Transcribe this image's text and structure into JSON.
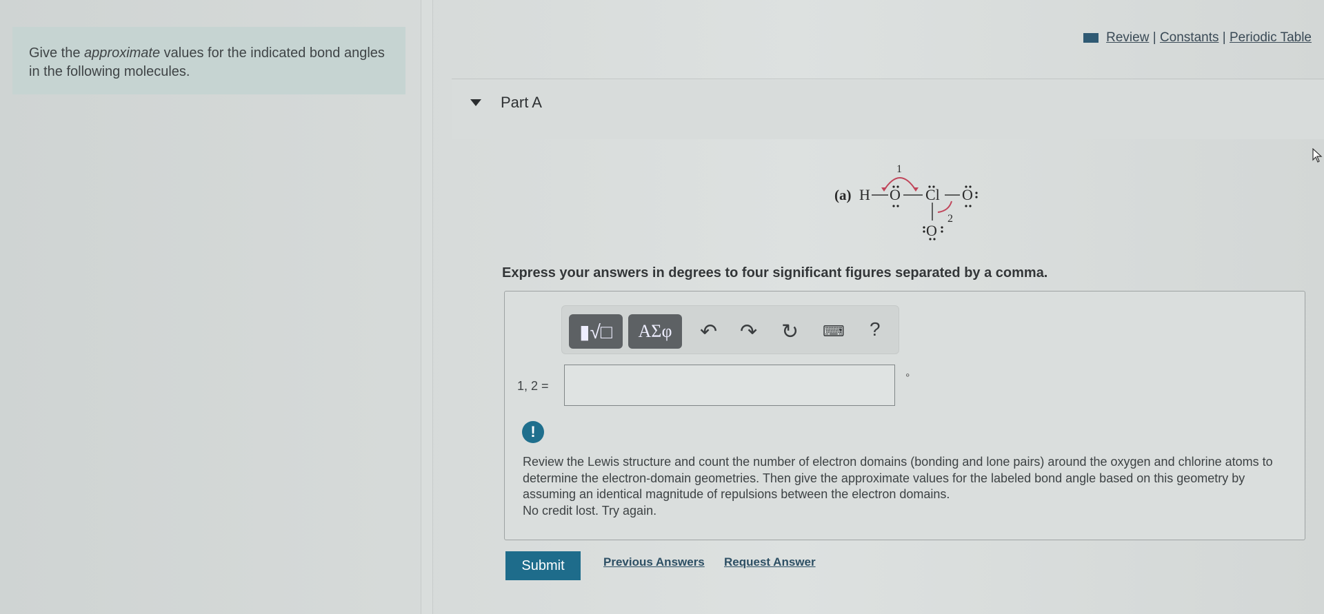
{
  "intro": {
    "text_before": "Give the ",
    "text_em": "approximate",
    "text_after": " values for the indicated bond angles in the following molecules."
  },
  "header_links": {
    "review": "Review",
    "constants": "Constants",
    "periodic_table": "Periodic Table",
    "separator": "|"
  },
  "part": {
    "title": "Part A"
  },
  "molecule": {
    "label": "(a)",
    "atoms": [
      "H",
      "O",
      "Cl",
      "O",
      "O"
    ],
    "angle_labels": [
      "1",
      "2"
    ],
    "arrow_color": "#c0455a"
  },
  "instructions": "Express your answers in degrees to four significant figures separated by a comma.",
  "toolbar": {
    "templates": "▮√□",
    "greek": "ΑΣφ",
    "help": "?",
    "icons": [
      "templates-icon",
      "greek-letters-icon",
      "undo-icon",
      "redo-icon",
      "reset-icon",
      "keyboard-icon",
      "help-icon"
    ]
  },
  "answer": {
    "label": "1, 2 =",
    "value": "",
    "unit": "°"
  },
  "feedback": {
    "icon": "!",
    "message": "Review the Lewis structure and count the number of electron domains (bonding and lone pairs) around the oxygen and chlorine atoms to determine the electron-domain geometries. Then give the approximate values for the labeled bond angle based on this geometry by assuming an identical magnitude of repulsions between the electron domains.",
    "status": "No credit lost. Try again."
  },
  "actions": {
    "submit": "Submit",
    "previous_answers": "Previous Answers",
    "request_answer": "Request Answer"
  },
  "colors": {
    "accent": "#1e6c8b",
    "link": "#2d4f64"
  }
}
